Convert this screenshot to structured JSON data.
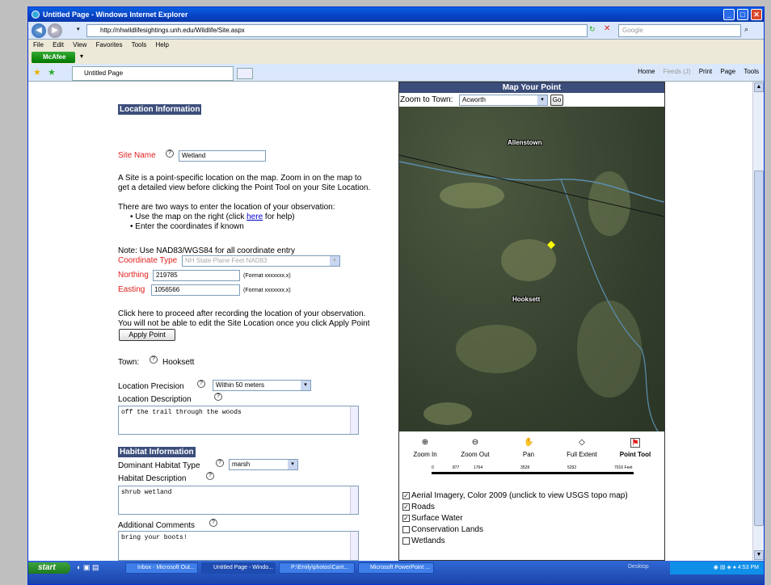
{
  "window": {
    "title": "Untitled Page - Windows Internet Explorer",
    "url": "http://nhwildlifesightings.unh.edu/Wildlife/Site.aspx",
    "search_placeholder": "Google",
    "menu": [
      "File",
      "Edit",
      "View",
      "Favorites",
      "Tools",
      "Help"
    ],
    "mcafee": "McAfee",
    "tab_title": "Untitled Page",
    "toolbar": [
      "Home",
      "Feeds (J)",
      "Print",
      "Page",
      "Tools"
    ]
  },
  "form": {
    "location_header": "Location Information",
    "site_name_label": "Site Name",
    "site_name_value": "Wetland",
    "intro1": "A Site is a point-specific location on the map. Zoom in on the map to",
    "intro2": "get a detailed view before clicking the Point Tool on your Site Location.",
    "ways": "There are two ways to enter the location of your observation:",
    "bullet1_pre": "Use the map on the right (click ",
    "bullet1_link": "here",
    "bullet1_post": " for help)",
    "bullet2": "Enter the coordinates if known",
    "note": "Note: Use NAD83/WGS84 for all coordinate entry",
    "coord_type_label": "Coordinate Type",
    "coord_type_value": "NH State Plane Feet NAD83",
    "northing_label": "Northing",
    "northing_value": "219785",
    "easting_label": "Easting",
    "easting_value": "1056566",
    "format_hint": "(Format xxxxxxx.x)",
    "proceed1": "Click here to proceed after recording the location of your observation.",
    "proceed2": "You will not be able to edit the Site Location once you click Apply Point",
    "apply_button": "Apply Point",
    "town_label": "Town:",
    "town_value": "Hooksett",
    "precision_label": "Location Precision",
    "precision_value": "Within 50 meters",
    "desc_label": "Location Description",
    "desc_value": "off the trail through the woods",
    "habitat_header": "Habitat Information",
    "dominant_label": "Dominant Habitat Type",
    "dominant_value": "marsh",
    "habitat_desc_label": "Habitat Description",
    "habitat_desc_value": "shrub wetland",
    "comments_label": "Additional Comments",
    "comments_value": "bring your boots!"
  },
  "map": {
    "title": "Map Your Point",
    "zoom_label": "Zoom to Town:",
    "zoom_value": "Acworth",
    "go_button": "Go",
    "label_allenstown": "Allenstown",
    "label_hooksett": "Hooksett",
    "tools": [
      "Zoom In",
      "Zoom Out",
      "Pan",
      "Full Extent",
      "Point Tool"
    ],
    "scale_ticks": [
      "0",
      "877",
      "1764",
      "3528",
      "5292",
      "7016 Feet"
    ],
    "layers": [
      {
        "label": "Aerial Imagery, Color 2009 (unclick to view USGS topo map)",
        "checked": true
      },
      {
        "label": "Roads",
        "checked": true
      },
      {
        "label": "Surface Water",
        "checked": true
      },
      {
        "label": "Conservation Lands",
        "checked": false
      },
      {
        "label": "Wetlands",
        "checked": false
      }
    ]
  },
  "taskbar": {
    "start": "start",
    "tasks": [
      "Inbox - Microsoft Out...",
      "Untitled Page - Windo...",
      "P:\\Emily\\photos\\Cant...",
      "Microsoft PowerPoint ..."
    ],
    "desktop": "Desktop",
    "clock": "4:53 PM"
  }
}
